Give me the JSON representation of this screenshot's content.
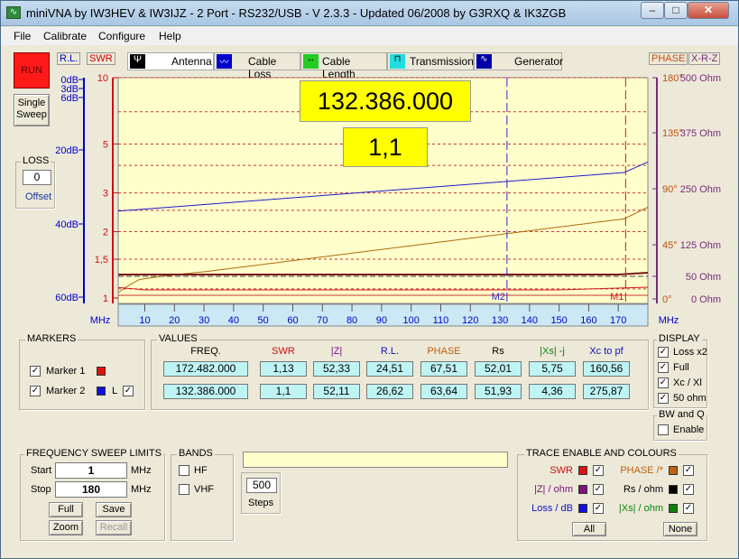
{
  "window": {
    "title": "miniVNA by IW3HEV & IW3IJZ - 2 Port - RS232/USB - V 2.3.3 - Updated 06/2008 by G3RXQ & IK3ZGB",
    "minimize": "–",
    "maximize": "□",
    "close": "✕"
  },
  "menu": [
    "File",
    "Calibrate",
    "Configure",
    "Help"
  ],
  "left_panel": {
    "run_label": "RUN",
    "single_sweep_line1": "Single",
    "single_sweep_line2": "Sweep",
    "loss_title": "LOSS",
    "loss_value": "0",
    "offset_label": "Offset",
    "rl_label": "R.L.",
    "swr_label": "SWR"
  },
  "tabs": [
    {
      "label": "Antenna",
      "icon": "antenna-icon"
    },
    {
      "label": "Cable Loss",
      "icon": "cable-loss-icon"
    },
    {
      "label": "Cable Length",
      "icon": "cable-length-icon"
    },
    {
      "label": "Transmission",
      "icon": "transmission-icon"
    },
    {
      "label": "Generator",
      "icon": "generator-icon"
    }
  ],
  "right_toggles": {
    "phase": "PHASE",
    "xrz": "X-R-Z"
  },
  "readouts": {
    "marker_freq": "132.386.000",
    "marker_swr": "1,1"
  },
  "chart": {
    "db_ticks": [
      "0dB",
      "3dB",
      "6dB",
      "20dB",
      "40dB",
      "60dB"
    ],
    "swr_ticks": [
      "10",
      "5",
      "3",
      "2",
      "1,5",
      "1"
    ],
    "right_ticks": [
      {
        "phase": "180°",
        "ohm": "500 Ohm"
      },
      {
        "phase": "135°",
        "ohm": "375 Ohm"
      },
      {
        "phase": "90°",
        "ohm": "250 Ohm"
      },
      {
        "phase": "45°",
        "ohm": "125 Ohm"
      },
      {
        "phase": "",
        "ohm": "50 Ohm"
      },
      {
        "phase": "0°",
        "ohm": "0 Ohm"
      }
    ],
    "x_ticks": [
      "10",
      "20",
      "30",
      "40",
      "50",
      "60",
      "70",
      "80",
      "90",
      "100",
      "110",
      "120",
      "130",
      "140",
      "150",
      "160",
      "170"
    ],
    "x_unit": "MHz",
    "marker1_label": "M1",
    "marker2_label": "M2",
    "colors": {
      "plot_bg": "#ffffcc",
      "blue_trace": "#1a1acc",
      "orange_trace": "#b06a10",
      "red_trace": "#cc1a1a",
      "maroon_trace": "#7a1a1a"
    }
  },
  "markers": {
    "title": "MARKERS",
    "marker1": {
      "label": "Marker 1",
      "checked": "✓"
    },
    "marker2": {
      "label": "Marker 2",
      "checked": "✓",
      "l_label": "L",
      "l_checked": "✓"
    }
  },
  "values": {
    "title": "VALUES",
    "headers": [
      "FREQ.",
      "SWR",
      "|Z|",
      "R.L.",
      "PHASE",
      "Rs",
      "|Xs| -j",
      "Xc to pf"
    ],
    "row1": [
      "172.482.000",
      "1,13",
      "52,33",
      "24,51",
      "67,51",
      "52,01",
      "5,75",
      "160,56"
    ],
    "row2": [
      "132.386.000",
      "1,1",
      "52,11",
      "26,62",
      "63,64",
      "51,93",
      "4,36",
      "275,87"
    ]
  },
  "display": {
    "title": "DISPLAY",
    "options": [
      {
        "label": "Loss x2",
        "check": "✓"
      },
      {
        "label": "Full",
        "check": "✓"
      },
      {
        "label": "Xc / Xl",
        "check": "✓"
      },
      {
        "label": "50 ohm",
        "check": "✓"
      }
    ]
  },
  "bwq": {
    "title": "BW and Q",
    "enable": "Enable"
  },
  "sweep": {
    "title": "FREQUENCY SWEEP LIMITS",
    "start_label": "Start",
    "start_value": "1",
    "stop_label": "Stop",
    "stop_value": "180",
    "unit": "MHz",
    "full": "Full",
    "save": "Save",
    "zoom": "Zoom",
    "recall": "Recall"
  },
  "bands": {
    "title": "BANDS",
    "hf": "HF",
    "vhf": "VHF"
  },
  "steps": {
    "value": "500",
    "label": "Steps"
  },
  "traces": {
    "title": "TRACE ENABLE AND COLOURS",
    "items": [
      {
        "label": "SWR",
        "color": "#e01010",
        "check": "✓"
      },
      {
        "label": "PHASE /*",
        "color": "#c06010",
        "check": "✓"
      },
      {
        "label": "|Z| / ohm",
        "color": "#801080",
        "check": "✓"
      },
      {
        "label": "Rs / ohm",
        "color": "#000000",
        "check": "✓"
      },
      {
        "label": "Loss / dB",
        "color": "#1010e0",
        "check": "✓"
      },
      {
        "label": "|Xs| / ohm",
        "color": "#108010",
        "check": "✓"
      }
    ],
    "all": "All",
    "none": "None"
  }
}
